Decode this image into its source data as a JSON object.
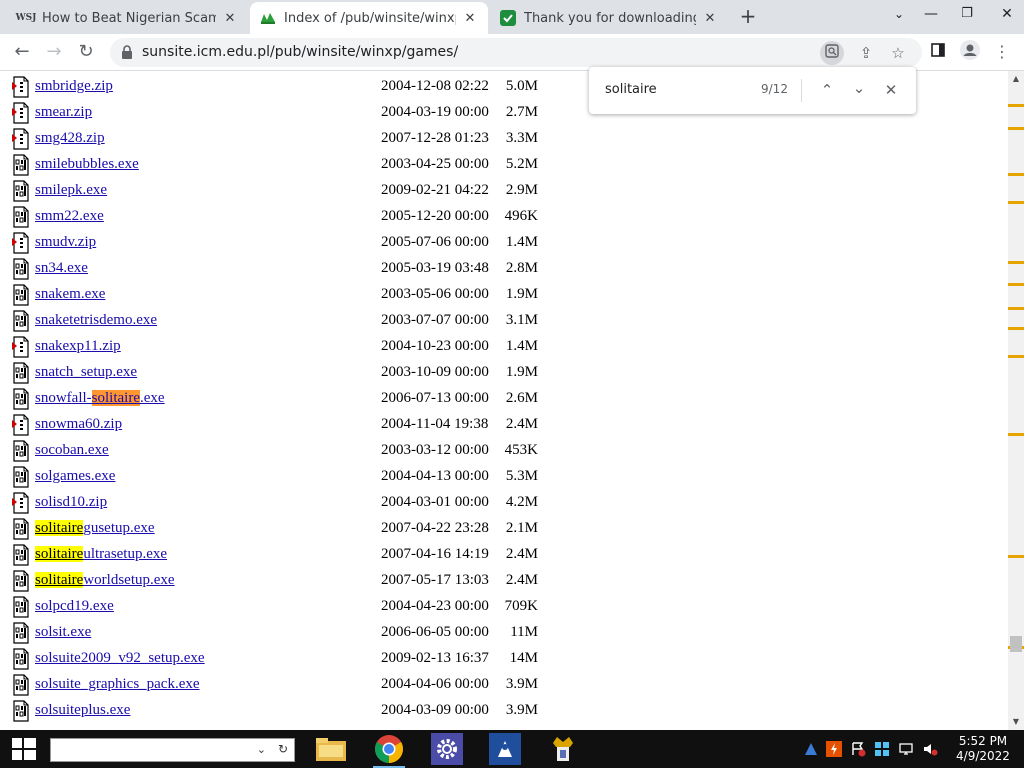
{
  "browser": {
    "tabs": [
      {
        "title": "How to Beat Nigerian Scams - W",
        "favicon": "WSJ",
        "active": false
      },
      {
        "title": "Index of /pub/winsite/winxp/gam",
        "favicon": "winsite",
        "active": true
      },
      {
        "title": "Thank you for downloading Solit",
        "favicon": "download",
        "active": false
      }
    ],
    "url": "sunsite.icm.edu.pl/pub/winsite/winxp/games/"
  },
  "find_bar": {
    "query": "solitaire",
    "count": "9/12"
  },
  "files": [
    {
      "pre": "smbridge.zip",
      "mid": "",
      "post": "",
      "date": "2004-12-08 02:22",
      "size": "5.0M",
      "type": "zip"
    },
    {
      "pre": "smear.zip",
      "mid": "",
      "post": "",
      "date": "2004-03-19 00:00",
      "size": "2.7M",
      "type": "zip"
    },
    {
      "pre": "smg428.zip",
      "mid": "",
      "post": "",
      "date": "2007-12-28 01:23",
      "size": "3.3M",
      "type": "zip"
    },
    {
      "pre": "smilebubbles.exe",
      "mid": "",
      "post": "",
      "date": "2003-04-25 00:00",
      "size": "5.2M",
      "type": "exe"
    },
    {
      "pre": "smilepk.exe",
      "mid": "",
      "post": "",
      "date": "2009-02-21 04:22",
      "size": "2.9M",
      "type": "exe"
    },
    {
      "pre": "smm22.exe",
      "mid": "",
      "post": "",
      "date": "2005-12-20 00:00",
      "size": "496K",
      "type": "exe"
    },
    {
      "pre": "smudv.zip",
      "mid": "",
      "post": "",
      "date": "2005-07-06 00:00",
      "size": "1.4M",
      "type": "zip"
    },
    {
      "pre": "sn34.exe",
      "mid": "",
      "post": "",
      "date": "2005-03-19 03:48",
      "size": "2.8M",
      "type": "exe"
    },
    {
      "pre": "snakem.exe",
      "mid": "",
      "post": "",
      "date": "2003-05-06 00:00",
      "size": "1.9M",
      "type": "exe"
    },
    {
      "pre": "snaketetrisdemo.exe",
      "mid": "",
      "post": "",
      "date": "2003-07-07 00:00",
      "size": "3.1M",
      "type": "exe"
    },
    {
      "pre": "snakexp11.zip",
      "mid": "",
      "post": "",
      "date": "2004-10-23 00:00",
      "size": "1.4M",
      "type": "zip"
    },
    {
      "pre": "snatch_setup.exe",
      "mid": "",
      "post": "",
      "date": "2003-10-09 00:00",
      "size": "1.9M",
      "type": "exe"
    },
    {
      "pre": "snowfall-",
      "mid": "solitaire",
      "post": ".exe",
      "date": "2006-07-13 00:00",
      "size": "2.6M",
      "type": "exe",
      "hl": "cur"
    },
    {
      "pre": "snowma60.zip",
      "mid": "",
      "post": "",
      "date": "2004-11-04 19:38",
      "size": "2.4M",
      "type": "zip"
    },
    {
      "pre": "socoban.exe",
      "mid": "",
      "post": "",
      "date": "2003-03-12 00:00",
      "size": "453K",
      "type": "exe"
    },
    {
      "pre": "solgames.exe",
      "mid": "",
      "post": "",
      "date": "2004-04-13 00:00",
      "size": "5.3M",
      "type": "exe"
    },
    {
      "pre": "solisd10.zip",
      "mid": "",
      "post": "",
      "date": "2004-03-01 00:00",
      "size": "4.2M",
      "type": "zip"
    },
    {
      "pre": "",
      "mid": "solitaire",
      "post": "gusetup.exe",
      "date": "2007-04-22 23:28",
      "size": "2.1M",
      "type": "exe",
      "hl": "match"
    },
    {
      "pre": "",
      "mid": "solitaire",
      "post": "ultrasetup.exe",
      "date": "2007-04-16 14:19",
      "size": "2.4M",
      "type": "exe",
      "hl": "match"
    },
    {
      "pre": "",
      "mid": "solitaire",
      "post": "worldsetup.exe",
      "date": "2007-05-17 13:03",
      "size": "2.4M",
      "type": "exe",
      "hl": "match"
    },
    {
      "pre": "solpcd19.exe",
      "mid": "",
      "post": "",
      "date": "2004-04-23 00:00",
      "size": "709K",
      "type": "exe"
    },
    {
      "pre": "solsit.exe",
      "mid": "",
      "post": "",
      "date": "2006-06-05 00:00",
      "size": "11M",
      "type": "exe"
    },
    {
      "pre": "solsuite2009_v92_setup.exe",
      "mid": "",
      "post": "",
      "date": "2009-02-13 16:37",
      "size": "14M",
      "type": "exe"
    },
    {
      "pre": "solsuite_graphics_pack.exe",
      "mid": "",
      "post": "",
      "date": "2004-04-06 00:00",
      "size": "3.9M",
      "type": "exe"
    },
    {
      "pre": "solsuiteplus.exe",
      "mid": "",
      "post": "",
      "date": "2004-03-09 00:00",
      "size": "3.9M",
      "type": "exe"
    }
  ],
  "taskbar": {
    "time": "5:52 PM",
    "date": "4/9/2022"
  },
  "colors": {
    "link": "#1a0dab",
    "find_current": "#ff9632",
    "find_match": "#ffff00",
    "scroll_marker": "#e7a400"
  }
}
